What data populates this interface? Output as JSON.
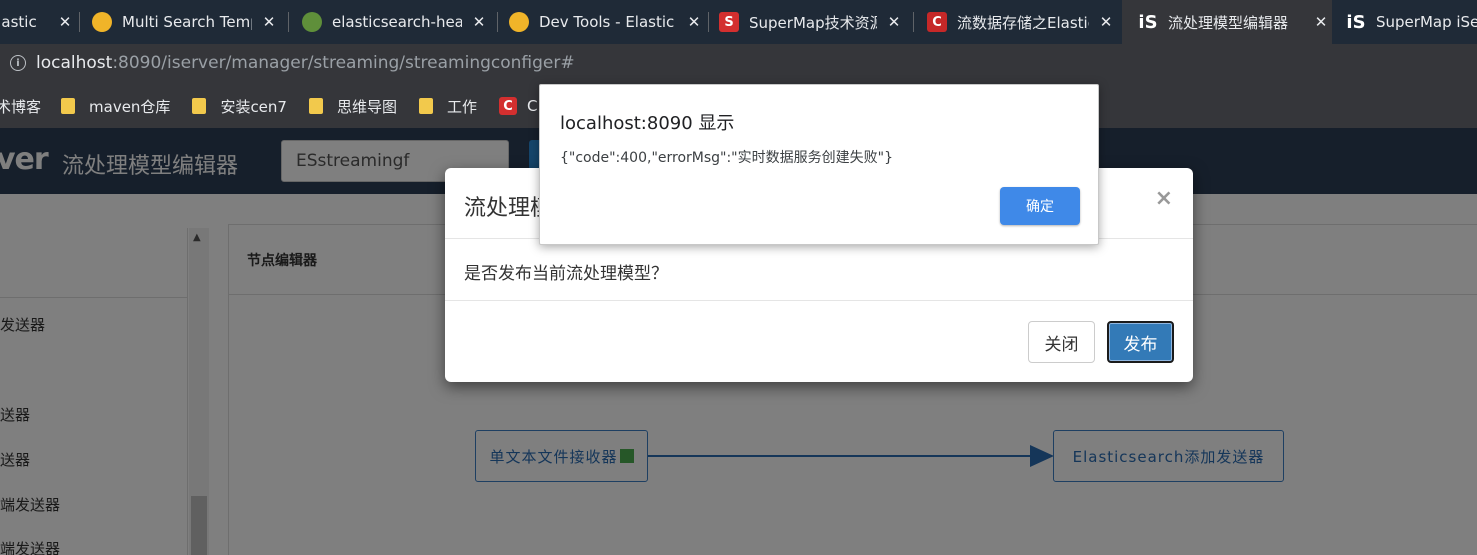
{
  "browser": {
    "tabs": [
      {
        "title": "elastic",
        "favicon": "elastic-icon",
        "color": "#4a90d9",
        "active": false
      },
      {
        "title": "Multi Search Temp",
        "favicon": "elastic-multicolor-icon",
        "color": "#f0b429",
        "active": false
      },
      {
        "title": "elasticsearch-head",
        "favicon": "puzzle-icon",
        "color": "#5f8f3a",
        "active": false
      },
      {
        "title": "Dev Tools - Elastic",
        "favicon": "elastic-multicolor-icon",
        "color": "#f0b429",
        "active": false
      },
      {
        "title": "SuperMap技术资源",
        "favicon": "supermap-s-icon",
        "color": "#d32f2f",
        "active": false
      },
      {
        "title": "流数据存储之Elastic",
        "favicon": "csdn-c-icon",
        "color": "#c62828",
        "active": false
      },
      {
        "title": "流处理模型编辑器",
        "favicon": "iserver-is-icon",
        "color": "#1f2a37",
        "active": true
      },
      {
        "title": "SuperMap iSer",
        "favicon": "iserver-is-icon",
        "color": "#1f2a37",
        "active": false
      }
    ],
    "url_host": "localhost",
    "url_rest": ":8090/iserver/manager/streaming/streamingconfiger#",
    "bookmarks": [
      {
        "label": "术博客",
        "icon": "none"
      },
      {
        "label": "maven仓库",
        "icon": "folder-icon"
      },
      {
        "label": "安装cen7",
        "icon": "folder-icon"
      },
      {
        "label": "思维导图",
        "icon": "folder-icon"
      },
      {
        "label": "工作",
        "icon": "folder-icon"
      },
      {
        "label": "C",
        "icon": "csdn-c-icon"
      }
    ]
  },
  "app": {
    "logo": "ver",
    "title": "流处理模型编辑器",
    "model_name": "ESstreamingf",
    "sidebar_items": [
      "发送器",
      "送器",
      "送器",
      "端发送器",
      "端发送器"
    ],
    "editor_header": "节点编辑器",
    "nodes": {
      "source": "单文本文件接收器",
      "target": "Elasticsearch添加发送器"
    }
  },
  "modal": {
    "title": "流处理模型",
    "close_symbol": "×",
    "body": "是否发布当前流处理模型？",
    "close_button": "关闭",
    "publish_button": "发布"
  },
  "alert": {
    "title": "localhost:8090 显示",
    "message": "{\"code\":400,\"errorMsg\":\"实时数据服务创建失败\"}",
    "ok_button": "确定"
  }
}
